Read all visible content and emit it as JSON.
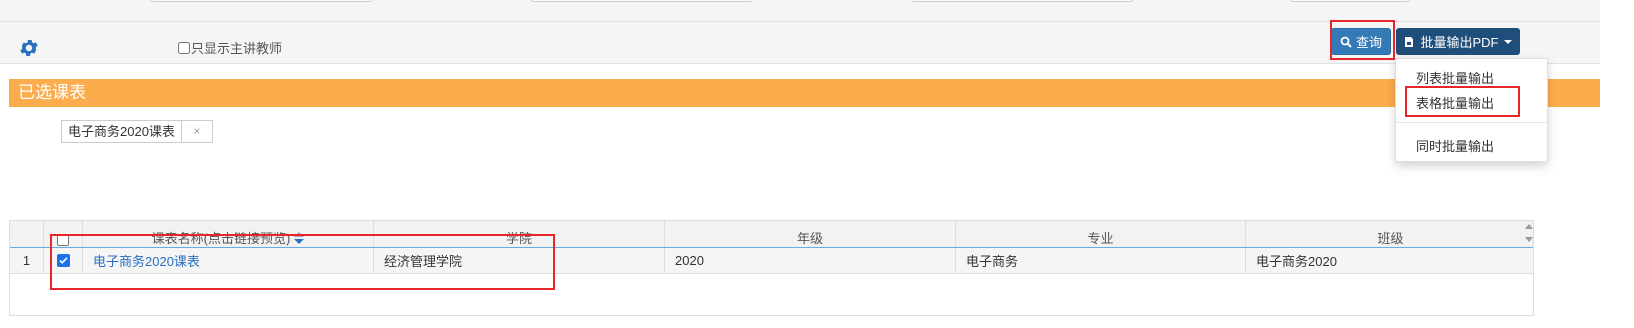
{
  "toolbar": {
    "teacher_only_label": "只显示主讲教师",
    "query_label": "查询",
    "batch_pdf_label": "批量输出PDF"
  },
  "dropdown": {
    "items": [
      "列表批量输出",
      "表格批量输出",
      "同时批量输出"
    ]
  },
  "selected": {
    "title": "已选课表",
    "chips": [
      {
        "label": "电子商务2020课表",
        "close": "×"
      }
    ]
  },
  "grid": {
    "headers": [
      "课表名称(点击链接预览)",
      "学院",
      "年级",
      "专业",
      "班级"
    ],
    "rows": [
      {
        "index": "1",
        "checked": true,
        "name": "电子商务2020课表",
        "college": "经济管理学院",
        "grade": "2020",
        "major": "电子商务",
        "class": "电子商务2020"
      }
    ]
  },
  "colors": {
    "accent": "#337ab7",
    "pdf_button": "#1f4e7a",
    "section_bar": "#fbad4e",
    "highlight": "#e8262a",
    "link": "#2a6fbf"
  },
  "icons": [
    "gear-icon",
    "search-icon",
    "pdf-icon",
    "caret-down-icon",
    "sort-icon",
    "checkbox-icon"
  ]
}
